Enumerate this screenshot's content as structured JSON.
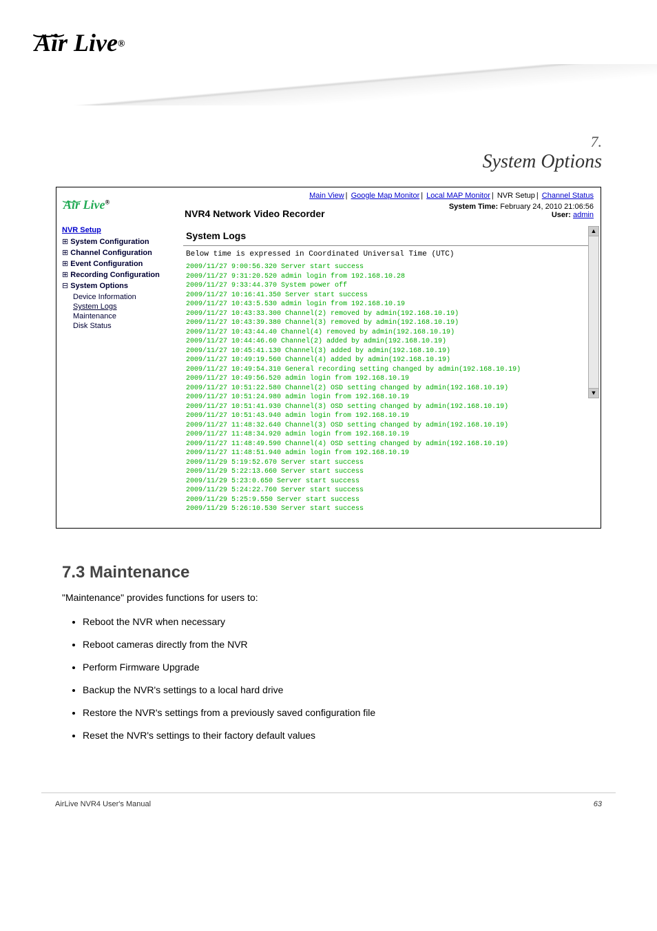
{
  "brand": "Air Live",
  "chapter": {
    "num": "7",
    "title": "System Options"
  },
  "nvr": {
    "product": "NVR4 Network Video Recorder",
    "links": [
      "Main View",
      "Google Map Monitor",
      "Local MAP Monitor",
      "NVR Setup",
      "Channel Status"
    ],
    "system_time_label": "System Time:",
    "system_time": "February 24, 2010 21:06:56",
    "user_label": "User:",
    "user": "admin",
    "sidebar": {
      "heading": "NVR Setup",
      "sections": [
        "System Configuration",
        "Channel Configuration",
        "Event Configuration",
        "Recording Configuration",
        "System Options"
      ],
      "sub": [
        "Device Information",
        "System Logs",
        "Maintenance",
        "Disk Status"
      ]
    },
    "main_title": "System Logs",
    "note": "Below time is expressed in Coordinated Universal Time (UTC)",
    "logs": [
      "2009/11/27 9:00:56.320 Server start success",
      "2009/11/27 9:31:20.520 admin login from 192.168.10.28",
      "2009/11/27 9:33:44.370 System power off",
      "2009/11/27 10:16:41.350 Server start success",
      "2009/11/27 10:43:5.530 admin login from 192.168.10.19",
      "2009/11/27 10:43:33.300 Channel(2) removed by admin(192.168.10.19)",
      "2009/11/27 10:43:39.380 Channel(3) removed by admin(192.168.10.19)",
      "2009/11/27 10:43:44.40 Channel(4) removed by admin(192.168.10.19)",
      "2009/11/27 10:44:46.60 Channel(2) added by admin(192.168.10.19)",
      "2009/11/27 10:45:41.130 Channel(3) added by admin(192.168.10.19)",
      "2009/11/27 10:49:19.560 Channel(4) added by admin(192.168.10.19)",
      "2009/11/27 10:49:54.310 General recording setting changed by admin(192.168.10.19)",
      "2009/11/27 10:49:56.520 admin login from 192.168.10.19",
      "2009/11/27 10:51:22.580 Channel(2) OSD setting changed by admin(192.168.10.19)",
      "2009/11/27 10:51:24.980 admin login from 192.168.10.19",
      "2009/11/27 10:51:41.930 Channel(3) OSD setting changed by admin(192.168.10.19)",
      "2009/11/27 10:51:43.940 admin login from 192.168.10.19",
      "2009/11/27 11:48:32.640 Channel(3) OSD setting changed by admin(192.168.10.19)",
      "2009/11/27 11:48:34.920 admin login from 192.168.10.19",
      "2009/11/27 11:48:49.590 Channel(4) OSD setting changed by admin(192.168.10.19)",
      "2009/11/27 11:48:51.940 admin login from 192.168.10.19",
      "2009/11/29 5:19:52.670 Server start success",
      "2009/11/29 5:22:13.660 Server start success",
      "2009/11/29 5:23:0.650 Server start success",
      "2009/11/29 5:24:22.760 Server start success",
      "2009/11/29 5:25:9.550 Server start success",
      "2009/11/29 5:26:10.530 Server start success"
    ]
  },
  "doc": {
    "heading": "7.3 Maintenance",
    "para": "\"Maintenance\" provides functions for users to:",
    "bullets": [
      "Reboot the NVR when necessary",
      "Reboot cameras directly from the NVR",
      "Perform Firmware Upgrade",
      "Backup the NVR's settings to a local hard drive",
      "Restore the NVR's settings from a previously saved configuration file",
      "Reset the NVR's settings to their factory default values"
    ]
  },
  "footer": {
    "left": "AirLive NVR4 User's Manual",
    "right": "63"
  }
}
